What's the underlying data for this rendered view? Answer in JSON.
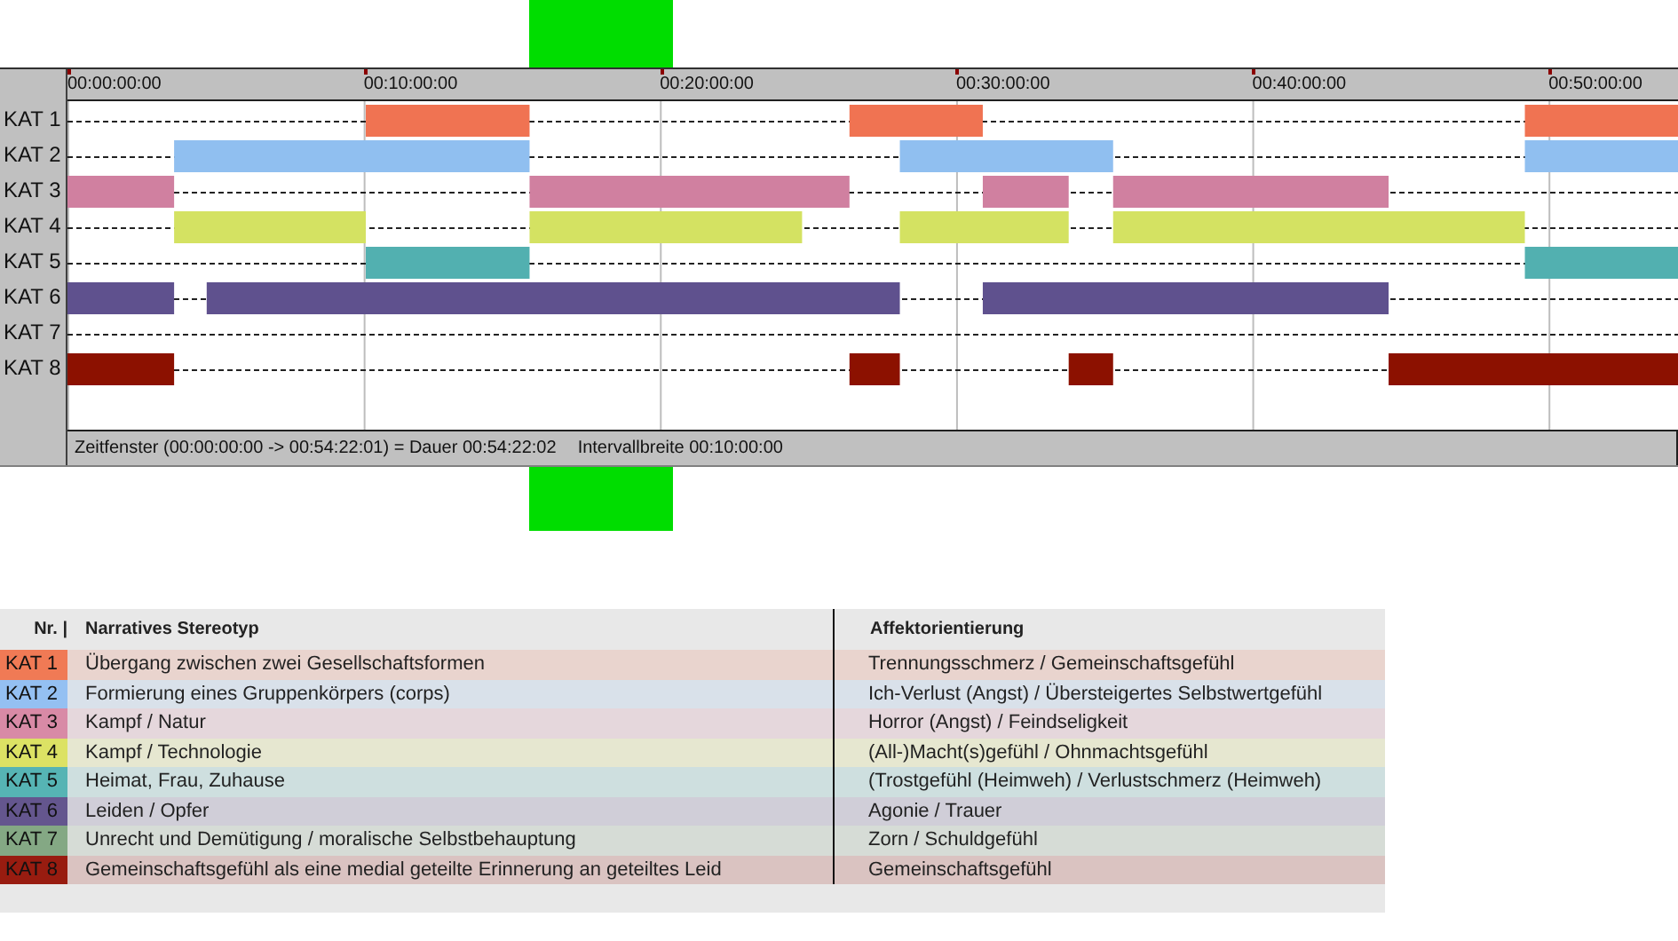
{
  "timeline": {
    "ticks": [
      "00:00:00:00",
      "00:10:00:00",
      "00:20:00:00",
      "00:30:00:00",
      "00:40:00:00",
      "00:50:00:00"
    ],
    "rows": [
      {
        "label": "KAT 1",
        "color": "#f07352"
      },
      {
        "label": "KAT 2",
        "color": "#90bff0"
      },
      {
        "label": "KAT 3",
        "color": "#d080a0"
      },
      {
        "label": "KAT 4",
        "color": "#d4e262"
      },
      {
        "label": "KAT 5",
        "color": "#52b0b0"
      },
      {
        "label": "KAT 6",
        "color": "#5f518e"
      },
      {
        "label": "KAT 7"
      },
      {
        "label": "KAT 8",
        "color": "#8c1100"
      }
    ],
    "status": [
      "Zeitfenster (00:00:00:00 -> 00:54:22:01) = Dauer 00:54:22:02",
      "Intervallbreite 00:10:00:00"
    ]
  },
  "legend": {
    "columns": [
      "Nr. |",
      "Narratives Stereotyp",
      "Affektorientierung"
    ],
    "rows": [
      {
        "nr": "KAT 1",
        "color": "#f07a55",
        "stereotype": "Übergang zwischen zwei Gesellschaftsformen",
        "affect": "Trennungsschmerz / Gemeinschaftsgefühl"
      },
      {
        "nr": "KAT 2",
        "color": "#94c0f2",
        "stereotype": "Formierung eines Gruppenkörpers (corps)",
        "affect": "Ich-Verlust (Angst) / Übersteigertes Selbstwertgefühl"
      },
      {
        "nr": "KAT 3",
        "color": "#d88aa6",
        "stereotype": "Kampf / Natur",
        "affect": "Horror (Angst) / Feindseligkeit"
      },
      {
        "nr": "KAT 4",
        "color": "#dce264",
        "stereotype": "Kampf / Technologie",
        "affect": "(All-)Macht(s)gefühl / Ohnmachtsgefühl"
      },
      {
        "nr": "KAT 5",
        "color": "#56b4b4",
        "stereotype": "Heimat, Frau, Zuhause",
        "affect": "(Trostgefühl (Heimweh) / Verlustschmerz (Heimweh)"
      },
      {
        "nr": "KAT 6",
        "color": "#64568e",
        "stereotype": "Leiden / Opfer",
        "affect": "Agonie / Trauer"
      },
      {
        "nr": "KAT 7",
        "color": "#84a884",
        "stereotype": "Unrecht und Demütigung / moralische Selbstbehauptung",
        "affect": "Zorn / Schuldgefühl"
      },
      {
        "nr": "KAT 8",
        "color": "#981c10",
        "stereotype": "Gemeinschaftsgefühl als eine medial geteilte Erinnerung an geteiltes Leid",
        "affect": "Gemeinschaftsgefühl"
      }
    ]
  }
}
